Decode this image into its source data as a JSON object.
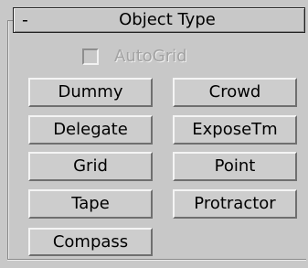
{
  "rollout": {
    "collapse_symbol": "-",
    "title": "Object Type"
  },
  "autogrid": {
    "label": "AutoGrid",
    "checked": false,
    "enabled": false
  },
  "buttons": [
    {
      "label": "Dummy"
    },
    {
      "label": "Crowd"
    },
    {
      "label": "Delegate"
    },
    {
      "label": "ExposeTm"
    },
    {
      "label": "Grid"
    },
    {
      "label": "Point"
    },
    {
      "label": "Tape"
    },
    {
      "label": "Protractor"
    },
    {
      "label": "Compass"
    }
  ]
}
